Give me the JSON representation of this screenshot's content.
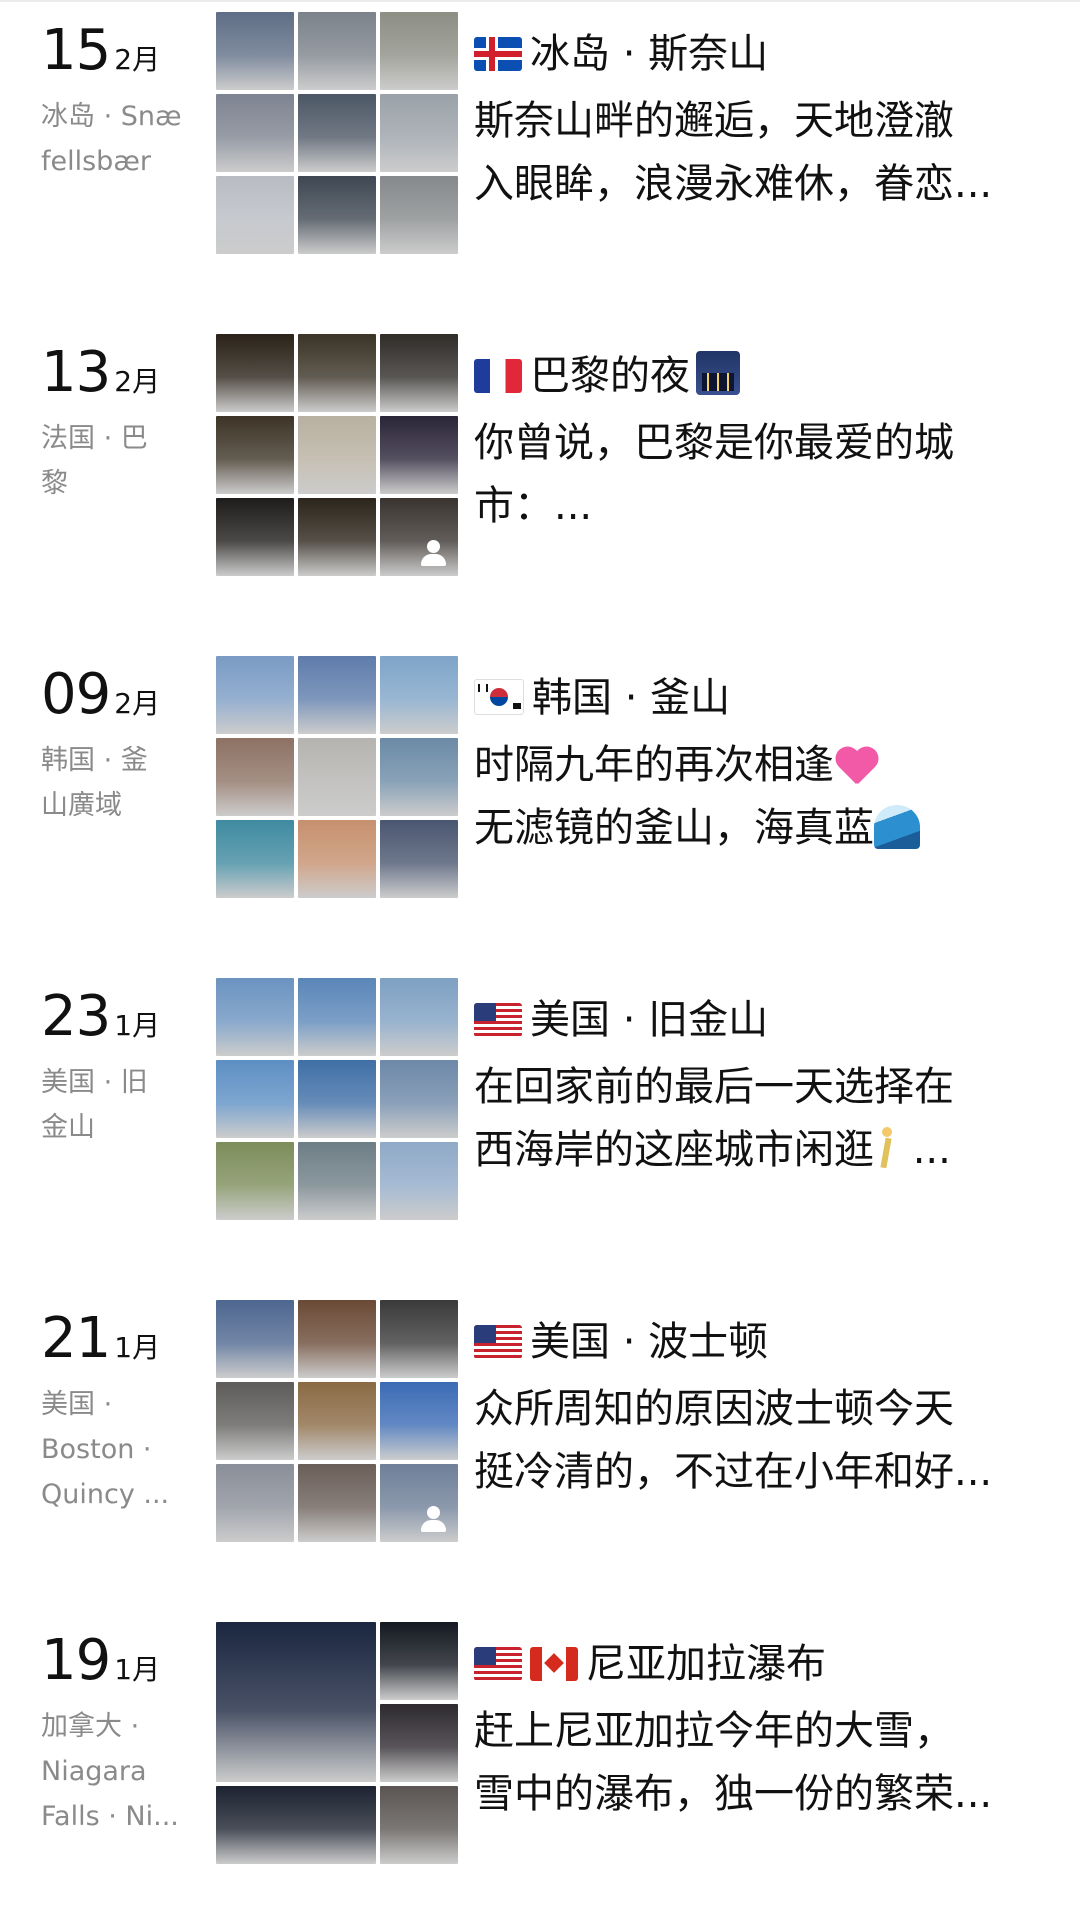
{
  "posts": [
    {
      "day": "15",
      "month": "2月",
      "location": [
        "冰岛 · Snæ",
        "fellsbær"
      ],
      "flags": [
        "is"
      ],
      "title": "冰岛 · 斯奈山",
      "desc": [
        "斯奈山畔的邂逅，天地澄澈",
        "入眼眸，浪漫永难休，眷恋..."
      ],
      "layout": "grid",
      "thumb_colors": [
        "#5f6e86",
        "#7b828a",
        "#8c8e84",
        "#7d8390",
        "#4c5765",
        "#9aa1a8",
        "#b8bcc2",
        "#3e4752",
        "#86898b"
      ]
    },
    {
      "day": "13",
      "month": "2月",
      "location": [
        "法国 · 巴",
        "黎"
      ],
      "flags": [
        "fr"
      ],
      "title": "巴黎的夜",
      "title_emoji": "night-city",
      "desc": [
        "你曾说，巴黎是你最爱的城",
        "市：..."
      ],
      "layout": "grid",
      "thumb_colors": [
        "#2a2218",
        "#3a3326",
        "#2f2c28",
        "#3d3426",
        "#b8b0a0",
        "#2a2438",
        "#1e1c1a",
        "#2b241a",
        "#3a3430"
      ],
      "people_tag": true
    },
    {
      "day": "09",
      "month": "2月",
      "location": [
        "韩国 · 釜",
        "山廣域"
      ],
      "flags": [
        "kr"
      ],
      "title": "韩国 · 釜山",
      "desc": [
        "时隔九年的再次相逢",
        "无滤镜的釜山，海真蓝"
      ],
      "desc_emoji": [
        "sparkling-heart",
        "water-wave"
      ],
      "layout": "grid",
      "thumb_colors": [
        "#7a9bc4",
        "#5e7cab",
        "#7ea4c8",
        "#8d7264",
        "#b4b3b0",
        "#6b8aa6",
        "#3f8aa0",
        "#c6906e",
        "#4a5670"
      ]
    },
    {
      "day": "23",
      "month": "1月",
      "location": [
        "美国 · 旧",
        "金山"
      ],
      "flags": [
        "us"
      ],
      "title": "美国 · 旧金山",
      "desc": [
        "在回家前的最后一天选择在",
        "西海岸的这座城市闲逛"
      ],
      "desc_emoji": [
        null,
        "person-walking"
      ],
      "desc_suffix": [
        "",
        " ..."
      ],
      "layout": "grid",
      "thumb_colors": [
        "#6b93c0",
        "#5a86b8",
        "#7ea0c2",
        "#5d8fc4",
        "#3f6fa6",
        "#6d88a8",
        "#7c8d5a",
        "#6e7e86",
        "#8fa9c8"
      ]
    },
    {
      "day": "21",
      "month": "1月",
      "location": [
        "美国 ·",
        "Boston ·",
        "Quincy ..."
      ],
      "flags": [
        "us"
      ],
      "title": "美国 · 波士顿",
      "desc": [
        "众所周知的原因波士顿今天",
        "挺冷清的，不过在小年和好..."
      ],
      "layout": "grid",
      "thumb_colors": [
        "#4e6790",
        "#6a4a36",
        "#3a3a3a",
        "#5d5c5a",
        "#8a6a44",
        "#3b6bb5",
        "#8a8e98",
        "#6a5e58",
        "#6e7f98"
      ],
      "people_tag": true
    },
    {
      "day": "19",
      "month": "1月",
      "location": [
        "加拿大 ·",
        "Niagara",
        "Falls · Ni..."
      ],
      "flags": [
        "us",
        "ca"
      ],
      "title": "尼亚加拉瀑布",
      "desc": [
        "赶上尼亚加拉今年的大雪，",
        "雪中的瀑布，独一份的繁荣..."
      ],
      "layout": "big",
      "thumb_colors": [
        "#1b2640",
        "#141820",
        "#2e2a30",
        "#1c2230",
        "#5a5552",
        "#3a3e48"
      ]
    }
  ]
}
